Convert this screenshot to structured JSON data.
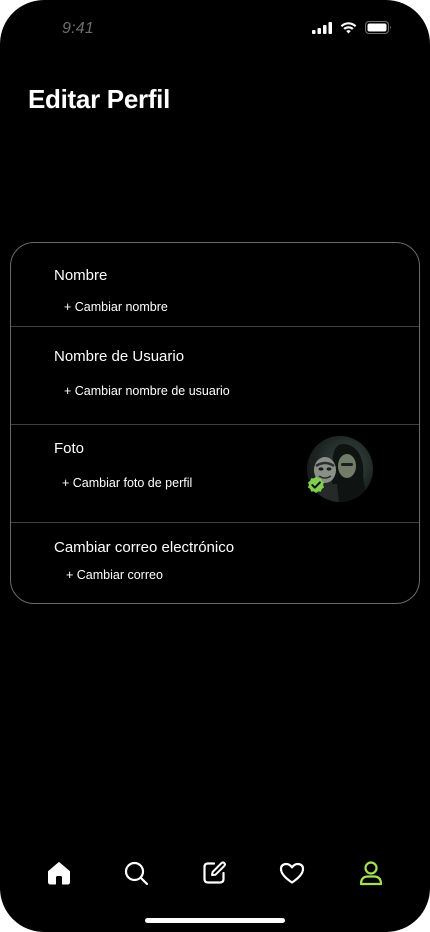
{
  "status_bar": {
    "time": "9:41",
    "icons": [
      "cellular-signal-icon",
      "wifi-icon",
      "battery-icon"
    ]
  },
  "header": {
    "title": "Editar Perfil"
  },
  "profile_card": {
    "rows": [
      {
        "label": "Nombre",
        "action": "+ Cambiar nombre"
      },
      {
        "label": "Nombre de Usuario",
        "action": "+ Cambiar nombre de usuario"
      },
      {
        "label": "Foto",
        "action": "+ Cambiar foto de perfil"
      },
      {
        "label": "Cambiar correo electrónico",
        "action": "+ Cambiar correo"
      }
    ],
    "avatar_badge": "verified-check-icon"
  },
  "bottom_nav": {
    "items": [
      {
        "icon": "home-icon",
        "active": false
      },
      {
        "icon": "search-icon",
        "active": false
      },
      {
        "icon": "edit-icon",
        "active": false
      },
      {
        "icon": "heart-icon",
        "active": false
      },
      {
        "icon": "user-icon",
        "active": true
      }
    ]
  },
  "colors": {
    "background": "#000000",
    "text": "#ffffff",
    "accent": "#a6e05a",
    "card_border": "#6a6a6a",
    "divider": "#3e3e3e"
  }
}
